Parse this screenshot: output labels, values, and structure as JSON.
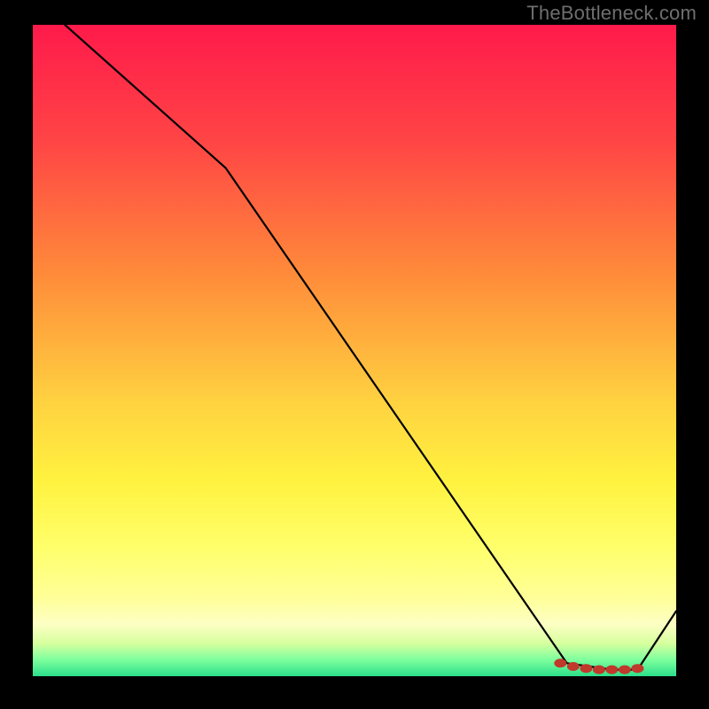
{
  "watermark": "TheBottleneck.com",
  "chart_data": {
    "type": "line",
    "title": "",
    "xlabel": "",
    "ylabel": "",
    "xlim": [
      0,
      100
    ],
    "ylim": [
      0,
      100
    ],
    "series": [
      {
        "name": "curve",
        "x": [
          5,
          30,
          83,
          90,
          94,
          100
        ],
        "values": [
          100,
          78,
          2,
          1,
          1,
          10
        ]
      }
    ],
    "markers": {
      "name": "optimal-zone",
      "x": [
        82,
        84,
        86,
        88,
        90,
        92,
        94
      ],
      "values": [
        2,
        1.5,
        1.2,
        1.0,
        1.0,
        1.0,
        1.2
      ]
    },
    "gradient_stops": [
      {
        "pct": 0,
        "color": "#ff1a4b"
      },
      {
        "pct": 18,
        "color": "#ff4545"
      },
      {
        "pct": 38,
        "color": "#ff8a3a"
      },
      {
        "pct": 58,
        "color": "#ffd240"
      },
      {
        "pct": 70,
        "color": "#fff23f"
      },
      {
        "pct": 80,
        "color": "#ffff6a"
      },
      {
        "pct": 88,
        "color": "#ffff99"
      },
      {
        "pct": 92,
        "color": "#fdffc4"
      },
      {
        "pct": 95,
        "color": "#d6ff9e"
      },
      {
        "pct": 97.5,
        "color": "#7dff9d"
      },
      {
        "pct": 100,
        "color": "#2bdf8a"
      }
    ]
  }
}
